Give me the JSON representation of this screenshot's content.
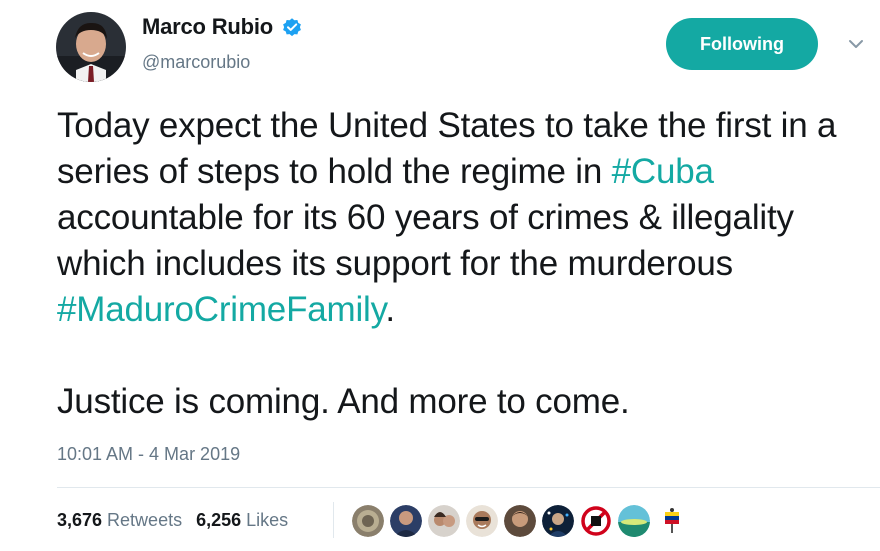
{
  "author": {
    "display_name": "Marco Rubio",
    "handle": "@marcorubio",
    "verified": true
  },
  "follow_button": {
    "label": "Following"
  },
  "tweet": {
    "segments": [
      {
        "text": "Today expect the United States to take the first in a series of steps to hold the regime in ",
        "type": "text"
      },
      {
        "text": "#Cuba",
        "type": "hashtag"
      },
      {
        "text": " accountable for its 60 years of crimes & illegality which includes its support for the murderous ",
        "type": "text"
      },
      {
        "text": "#MaduroCrimeFamily",
        "type": "hashtag"
      },
      {
        "text": ".",
        "type": "text"
      }
    ],
    "second_paragraph": "Justice is coming. And more to come."
  },
  "timestamp": "10:01 AM - 4 Mar 2019",
  "stats": {
    "retweets_count": "3,676",
    "retweets_label": "Retweets",
    "likes_count": "6,256",
    "likes_label": "Likes"
  },
  "icons": {
    "verified": "verified-badge-icon",
    "caret": "chevron-down-icon"
  },
  "colors": {
    "accent": "#14a9a3",
    "verified": "#1da1f2",
    "muted": "#657786",
    "text": "#14171a"
  }
}
